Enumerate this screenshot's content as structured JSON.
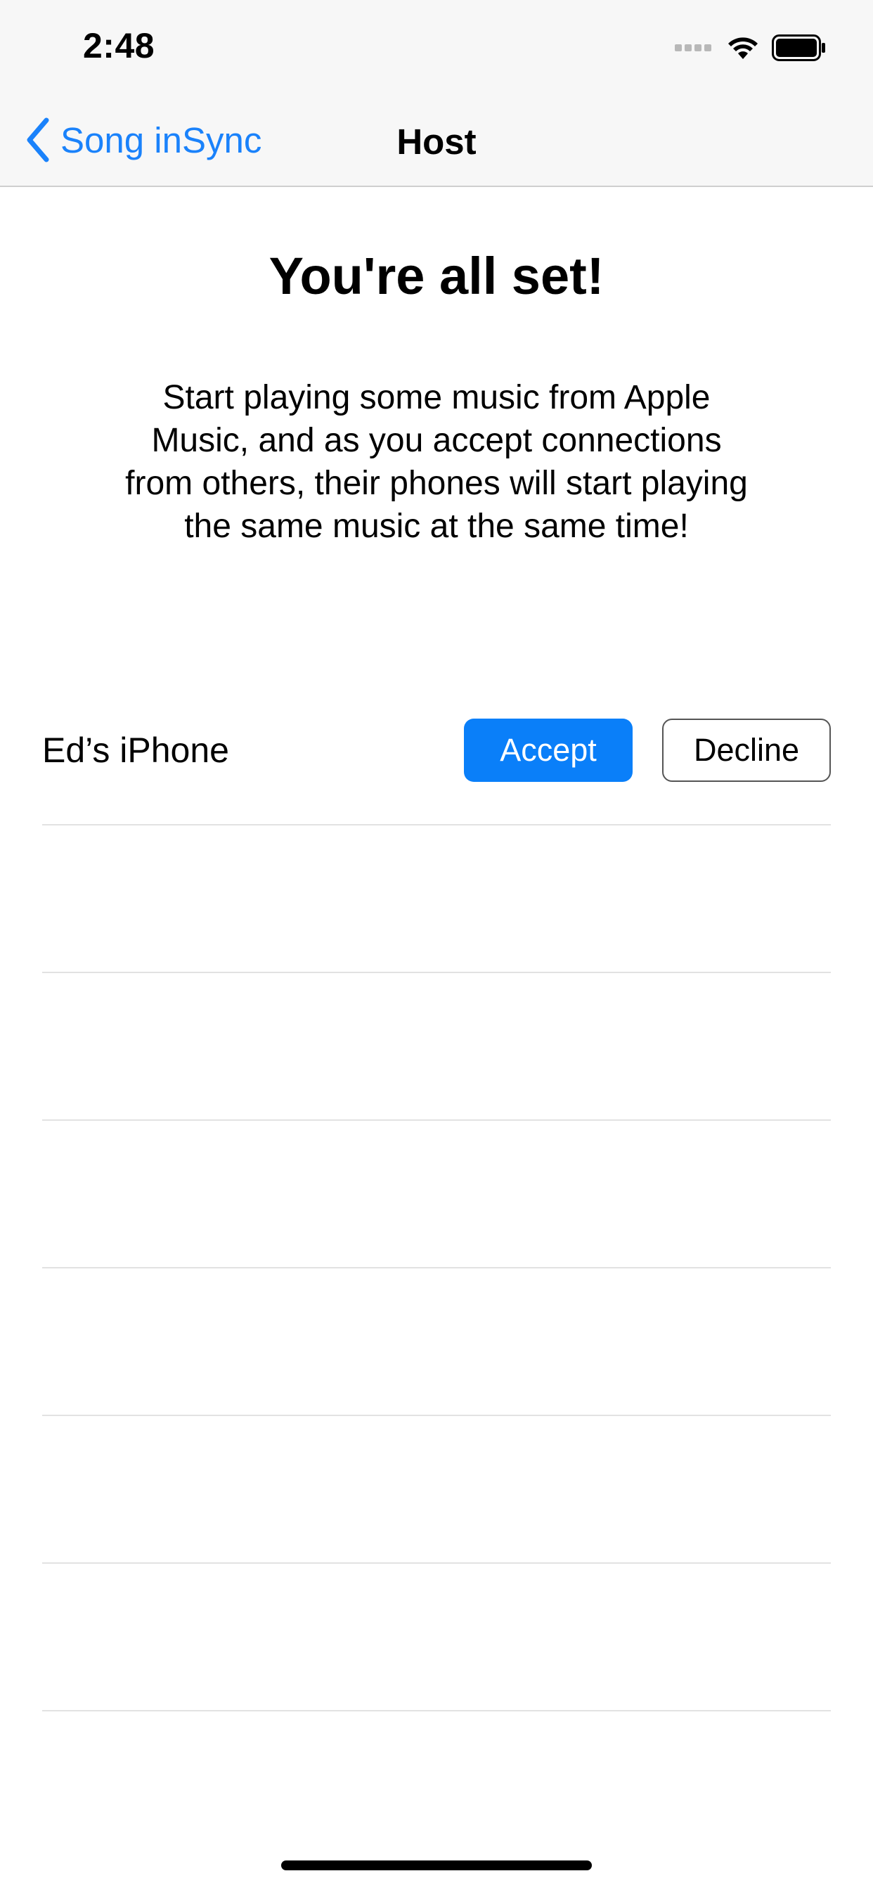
{
  "status_bar": {
    "time": "2:48"
  },
  "nav_bar": {
    "back_label": "Song inSync",
    "title": "Host"
  },
  "main": {
    "heading": "You're all set!",
    "intro": "Start playing some music from Apple Music, and as you accept connections from others, their phones will start playing the same music at the same time!"
  },
  "connections": [
    {
      "device_name": "Ed’s iPhone",
      "accept_label": "Accept",
      "decline_label": "Decline"
    }
  ],
  "colors": {
    "accent": "#0a7ff9",
    "nav_background": "#f7f7f7",
    "separator": "#e2e2e2"
  },
  "icons": {
    "back": "chevron-left-icon",
    "signal": "cellular-signal-icon",
    "wifi": "wifi-icon",
    "battery": "battery-icon"
  }
}
